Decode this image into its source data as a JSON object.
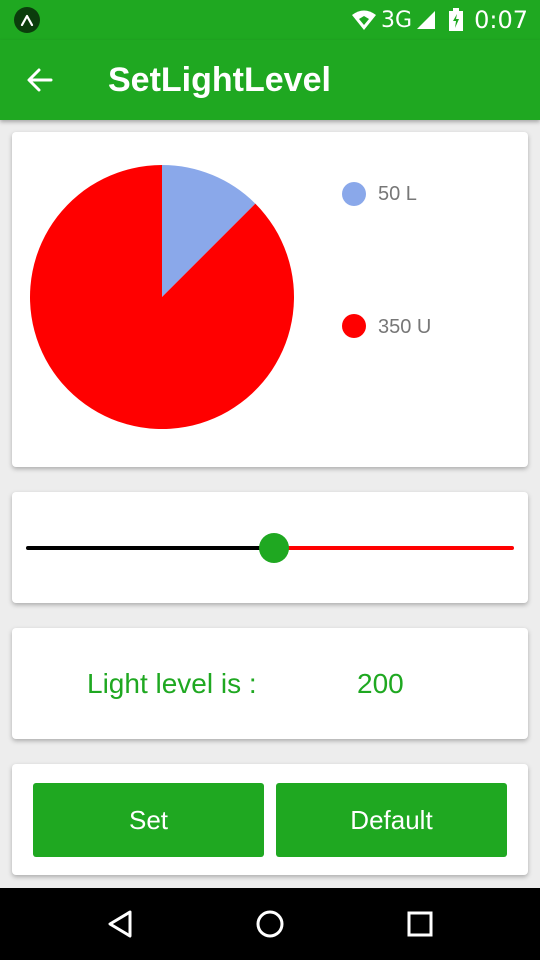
{
  "status_bar": {
    "network": "3G",
    "time": "0:07",
    "icons": [
      "app-notification-icon",
      "wifi-icon",
      "cell-signal-icon",
      "battery-icon"
    ]
  },
  "app_bar": {
    "title": "SetLightLevel",
    "back_icon": "arrow-back-icon"
  },
  "chart_data": {
    "type": "pie",
    "title": "",
    "slices": [
      {
        "label": "50 L",
        "value": 50,
        "color": "#8aa8ea"
      },
      {
        "label": "350 U",
        "value": 350,
        "color": "#ff0000"
      }
    ],
    "legend_position": "right"
  },
  "slider": {
    "value": 200,
    "min": 0,
    "max": 400,
    "fraction": 0.5,
    "active_color": "#000000",
    "inactive_color": "#ff0000",
    "thumb_color": "#1fa821"
  },
  "level": {
    "label": "Light level is :",
    "value": "200"
  },
  "buttons": {
    "set_label": "Set",
    "default_label": "Default"
  },
  "colors": {
    "accent": "#1fa821"
  },
  "nav_bar": {
    "icons": [
      "back-triangle-icon",
      "home-circle-icon",
      "recents-square-icon"
    ]
  }
}
